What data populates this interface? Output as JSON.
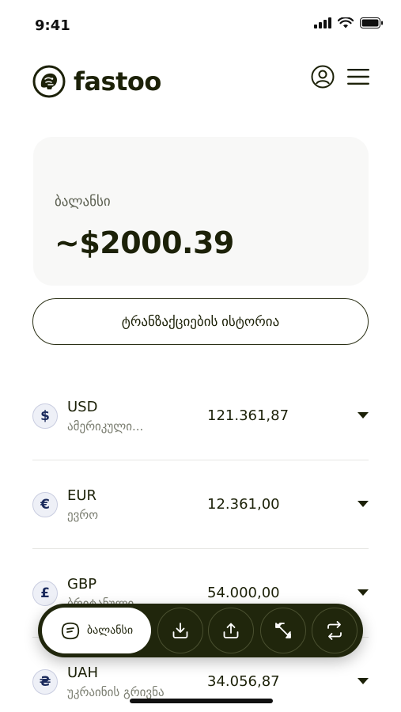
{
  "status_bar": {
    "time": "9:41"
  },
  "header": {
    "logo_text": "fastoo"
  },
  "balance": {
    "label": "ბალანსი",
    "amount": "~$2000.39"
  },
  "history_button": {
    "label": "ტრანზაქციების ისტორია"
  },
  "currencies": [
    {
      "code": "USD",
      "name": "ამერიკული...",
      "amount": "121.361,87",
      "symbol": "$"
    },
    {
      "code": "EUR",
      "name": "ევრო",
      "amount": "12.361,00",
      "symbol": "€"
    },
    {
      "code": "GBP",
      "name": "ბრიტანული...",
      "amount": "54.000,00",
      "symbol": "£"
    },
    {
      "code": "UAH",
      "name": "უკრაინის გრივნა",
      "amount": "34.056,87",
      "symbol": "₴"
    }
  ],
  "bottom_nav": {
    "active_label": "ბალანსი",
    "items": [
      "wallet-icon",
      "download-icon",
      "upload-icon",
      "exchange-icon",
      "swap-icon"
    ]
  },
  "colors": {
    "primary": "#20260c",
    "text": "#1c2108",
    "muted": "#7a7d70",
    "card": "#f8f8f7"
  }
}
